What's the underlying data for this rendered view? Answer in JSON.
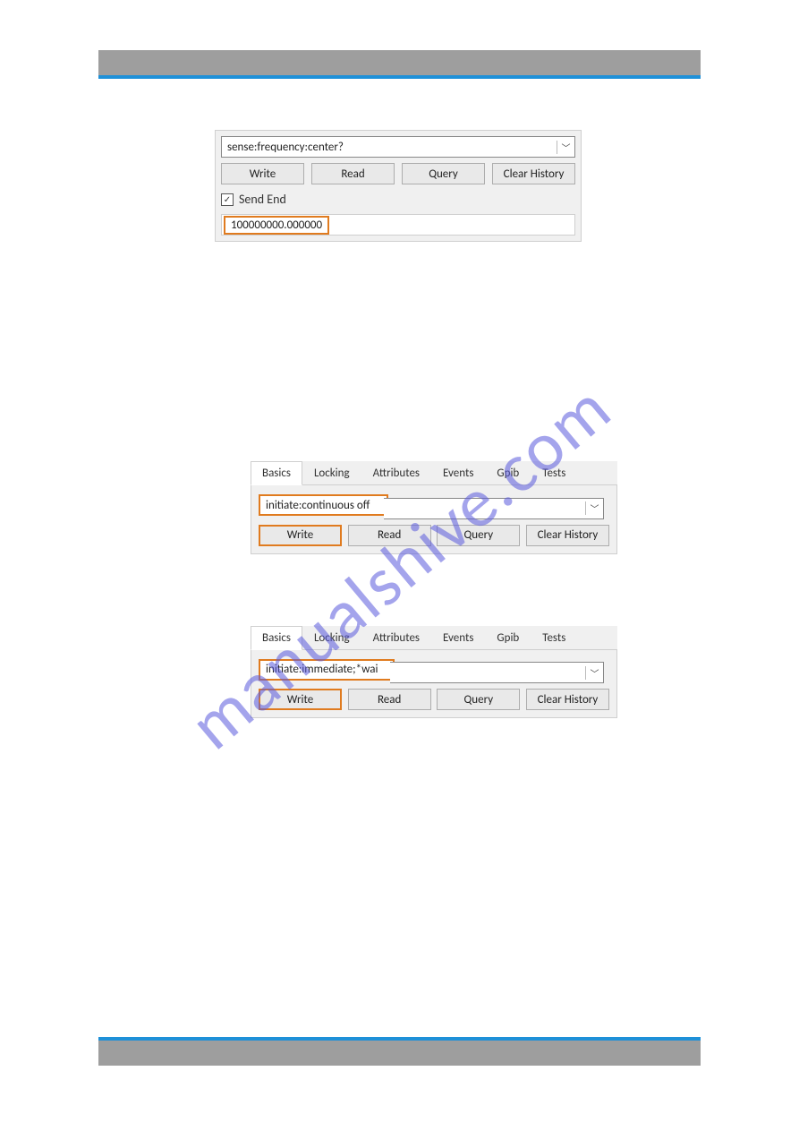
{
  "watermark": "manualshive.com",
  "panel1": {
    "command": "sense:frequency:center?",
    "buttons": {
      "write": "Write",
      "read": "Read",
      "query": "Query",
      "clear": "Clear History"
    },
    "checkbox_label": "Send End",
    "checkbox_checked": "✓",
    "result": "100000000.000000"
  },
  "tabs": {
    "basics": "Basics",
    "locking": "Locking",
    "attributes": "Attributes",
    "events": "Events",
    "gpib": "Gpib",
    "tests": "Tests"
  },
  "panel2": {
    "command": "initiate:continuous off",
    "buttons": {
      "write": "Write",
      "read": "Read",
      "query": "Query",
      "clear": "Clear History"
    }
  },
  "panel3": {
    "command": "initiate:immediate;*wai",
    "buttons": {
      "write": "Write",
      "read": "Read",
      "query": "Query",
      "clear": "Clear History"
    }
  },
  "icons": {
    "check": "✓"
  }
}
